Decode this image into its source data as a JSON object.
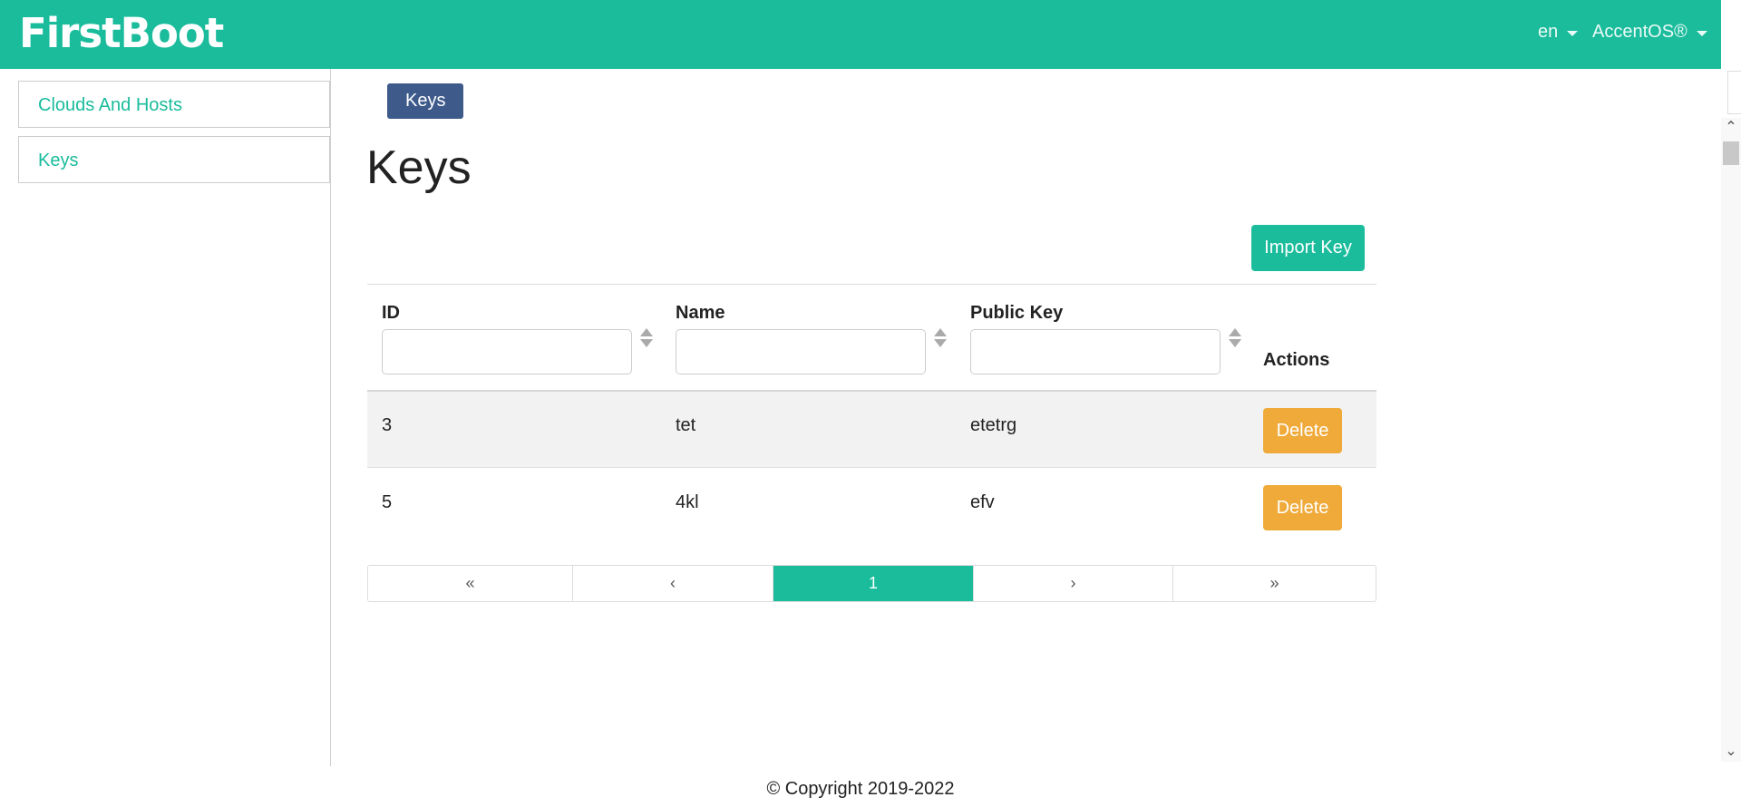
{
  "navbar": {
    "brand": "FirstBoot",
    "language": "en",
    "product": "AccentOS®"
  },
  "sidebar": {
    "items": [
      {
        "label": "Clouds And Hosts"
      },
      {
        "label": "Keys"
      }
    ]
  },
  "breadcrumb": {
    "label": "Keys"
  },
  "page": {
    "title": "Keys"
  },
  "toolbar": {
    "import_label": "Import Key"
  },
  "table": {
    "columns": {
      "id": "ID",
      "name": "Name",
      "public_key": "Public Key",
      "actions": "Actions"
    },
    "filters": {
      "id": "",
      "name": "",
      "public_key": ""
    },
    "rows": [
      {
        "id": "3",
        "name": "tet",
        "public_key": "etetrg",
        "action_label": "Delete"
      },
      {
        "id": "5",
        "name": "4kl",
        "public_key": "efv",
        "action_label": "Delete"
      }
    ]
  },
  "pagination": {
    "first": "«",
    "prev": "‹",
    "current": "1",
    "next": "›",
    "last": "»"
  },
  "footer": {
    "text": "© Copyright 2019-2022"
  }
}
